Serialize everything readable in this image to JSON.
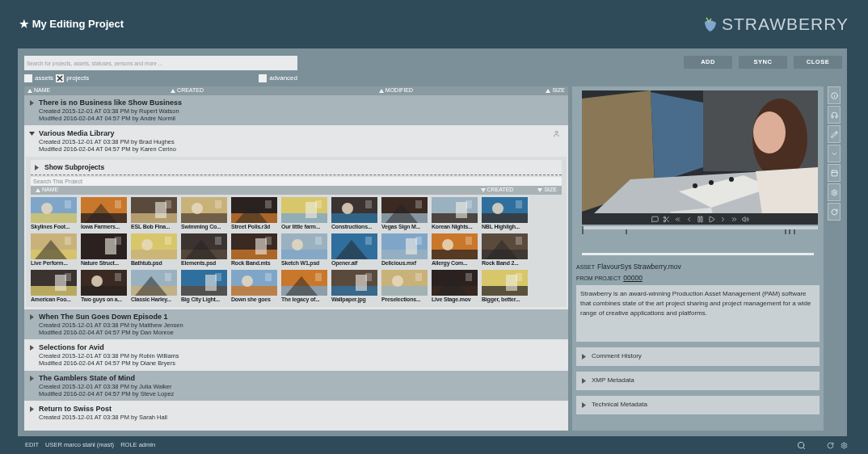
{
  "header": {
    "title_icon": "★",
    "title": "My Editing Project",
    "logo": "STRAWBERRY"
  },
  "search": {
    "placeholder": "Search for projects, assets, statuses, persons and more ..."
  },
  "filters": [
    {
      "label": "assets",
      "checked": false
    },
    {
      "label": "projects",
      "checked": true
    }
  ],
  "advanced": {
    "label": "advanced",
    "checked": false
  },
  "buttons": [
    "ADD",
    "SYNC",
    "CLOSE"
  ],
  "columns": [
    "NAME",
    "CREATED",
    "MODIFIED",
    "SIZE"
  ],
  "projects": [
    {
      "name": "There is no Business like Show Business",
      "created": "Created  2015-12-01 AT 03:38  PM by Rupert Watson",
      "modified": "Modified 2016-02-04 AT 04:57 PM by Andre Normil",
      "expanded": false
    },
    {
      "name": "Various Media Library",
      "created": "Created  2015-12-01 AT 03:38  PM by Brad Hughes",
      "modified": "Modified 2016-02-04 AT 04:57 PM by Karen Cerino",
      "expanded": true,
      "detail": {
        "subprojects": "Show Subprojects",
        "placeholder": "Search This Project",
        "columns": [
          "NAME",
          "CREATED",
          "SIZE"
        ],
        "assets": [
          {
            "name": "Skylines Foot..."
          },
          {
            "name": "Iowa Farmers..."
          },
          {
            "name": "ESL Bob Fina..."
          },
          {
            "name": "Swimming Co..."
          },
          {
            "name": "Street Polis.r3d"
          },
          {
            "name": "Our little farm..."
          },
          {
            "name": "Constructions..."
          },
          {
            "name": "Vegas Sign M..."
          },
          {
            "name": "Korean Nights..."
          },
          {
            "name": "NBL Highligh..."
          },
          {
            "name": "Live Perform..."
          },
          {
            "name": "Nature Struct..."
          },
          {
            "name": "Bathtub.psd"
          },
          {
            "name": "Elements.psd"
          },
          {
            "name": "Rock Band.mts"
          },
          {
            "name": "Sketch W1.psd"
          },
          {
            "name": "Opener.aif"
          },
          {
            "name": "Delicious.mxf"
          },
          {
            "name": "Allergy Com..."
          },
          {
            "name": "Rock Band 2..."
          },
          {
            "name": "American Foo..."
          },
          {
            "name": "Two guys on a..."
          },
          {
            "name": "Classic Harley..."
          },
          {
            "name": "Big City Light..."
          },
          {
            "name": "Down she goes"
          },
          {
            "name": "The legacy of..."
          },
          {
            "name": "Wallpaper.jpg"
          },
          {
            "name": "Preselections..."
          },
          {
            "name": "Live Stage.mov"
          },
          {
            "name": "Bigger, better..."
          }
        ]
      }
    },
    {
      "name": "When The Sun Goes Down Episode 1",
      "created": "Created  2015-12-01 AT 03:38  PM by Matthew Jensen",
      "modified": "Modified 2016-02-04 AT 04:57 PM by Dan Monroe",
      "expanded": false
    },
    {
      "name": "Selections for Avid",
      "created": "Created  2015-12-01 AT 03:38  PM by Robin Williams",
      "modified": "Modified 2016-02-04 AT 04:57 PM by Diane Bryers",
      "expanded": false
    },
    {
      "name": "The Gamblers State of Mind",
      "created": "Created  2015-12-01 AT 03:38  PM by Julia Walker",
      "modified": "Modified 2016-02-04 AT 04:57 PM by Steve Lopez",
      "expanded": false
    },
    {
      "name": "Return to Swiss Post",
      "created": "Created  2015-12-01 AT 03:38  PM by Sarah Hall",
      "expanded": false
    }
  ],
  "asset": {
    "label": "ASSET",
    "name": "FlavourSys Strawberry.mov",
    "project_label": "FROM PROJECT",
    "project": "00000",
    "description": "Strawberry is an award-winning Production Asset Management (PAM) software that combines state of the art project sharing and project management for a wide range of creative applications and platforms."
  },
  "sections": [
    {
      "title": "Comment History",
      "expanded": false
    },
    {
      "title": "XMP Metadata",
      "expanded": false
    },
    {
      "title": "Technical Metadata",
      "expanded": false
    }
  ],
  "footer": [
    {
      "label": "EDIT"
    },
    {
      "label": "USER",
      "value": "marco stahl (mast)"
    },
    {
      "label": "ROLE",
      "value": "admin"
    }
  ]
}
